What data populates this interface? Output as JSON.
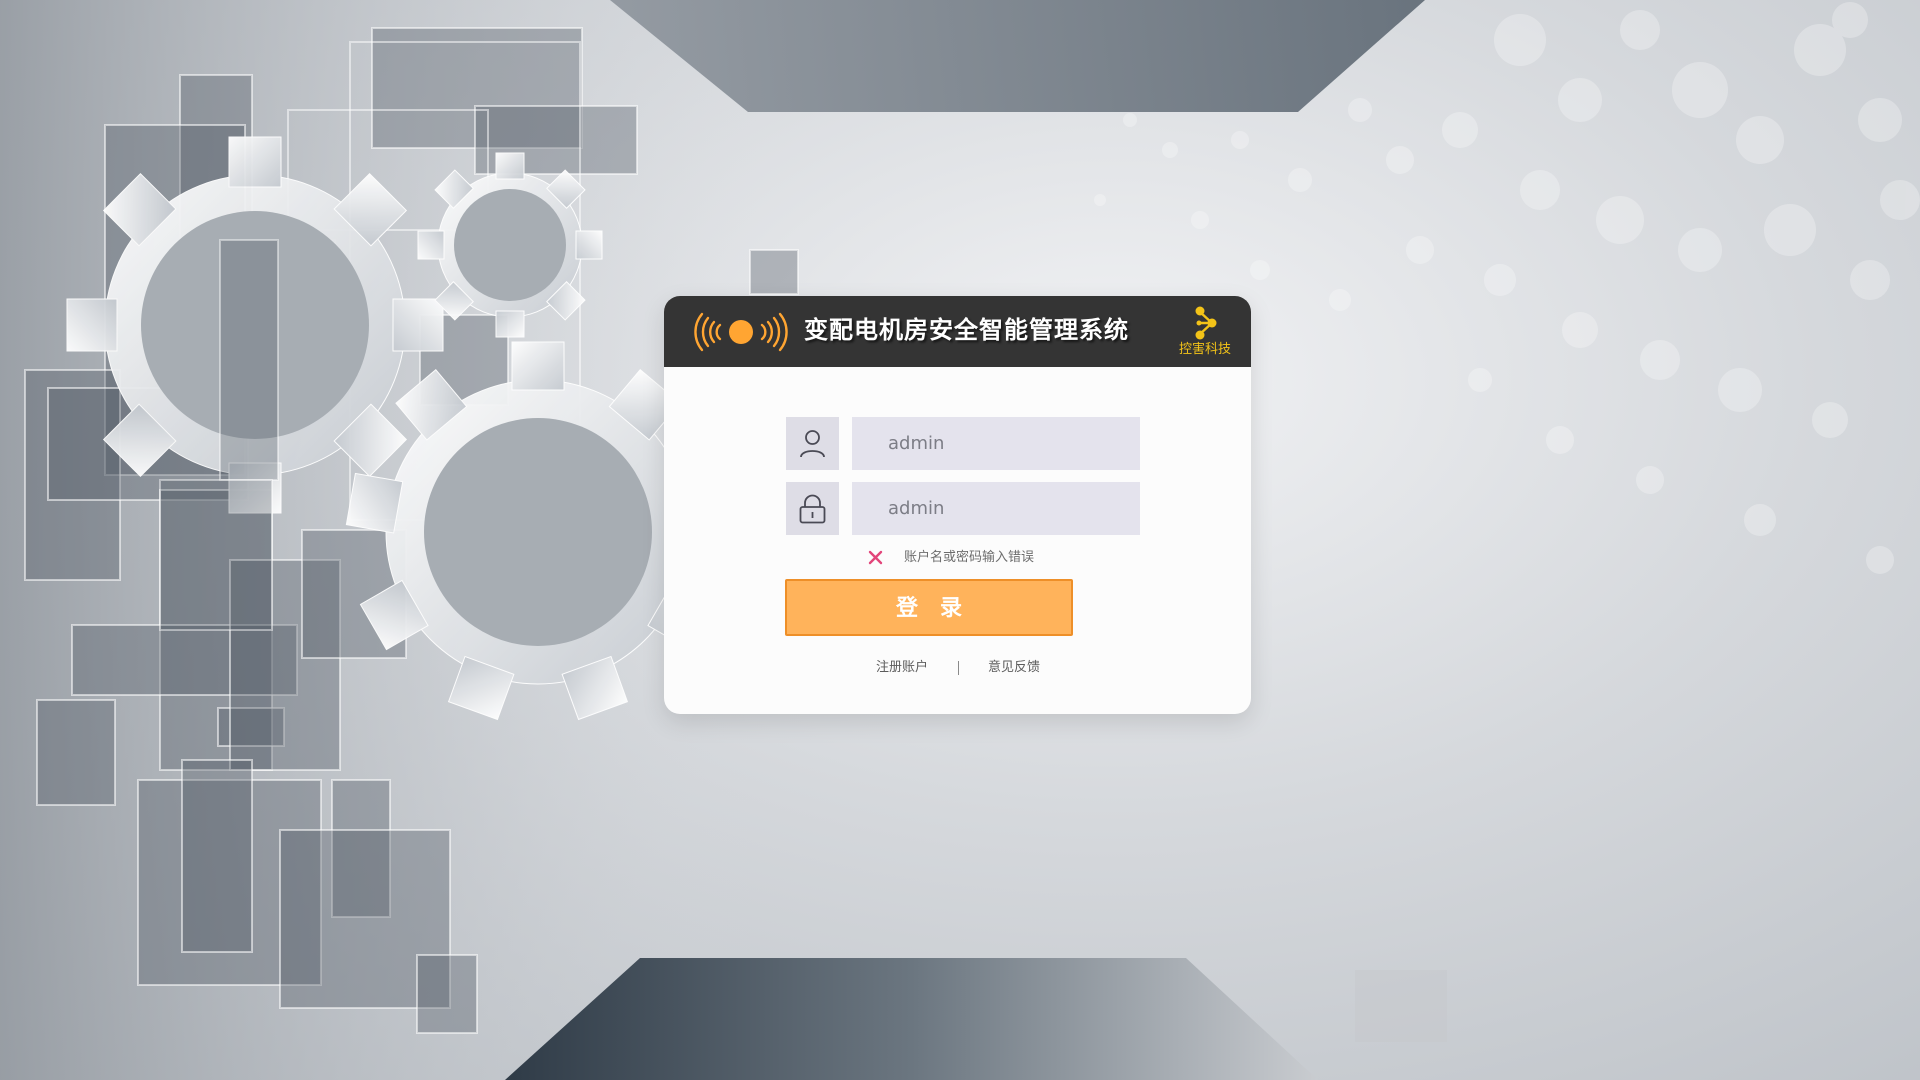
{
  "header": {
    "title": "变配电机房安全智能管理系统",
    "logo_icon": "broadcast-signal-icon",
    "brand_icon": "share-nodes-icon",
    "brand_name": "控害科技"
  },
  "form": {
    "username": {
      "value": "admin",
      "icon": "user-icon"
    },
    "password": {
      "value": "admin",
      "icon": "lock-icon"
    },
    "error": {
      "icon": "close-icon",
      "text": "账户名或密码输入错误"
    },
    "login_label": "登　录"
  },
  "footer": {
    "register_label": "注册账户",
    "separator": "|",
    "feedback_label": "意见反馈"
  },
  "colors": {
    "header_bg": "#343434",
    "accent_orange": "#ffb35b",
    "brand_yellow": "#f3c318",
    "error_pink": "#e2457a"
  }
}
